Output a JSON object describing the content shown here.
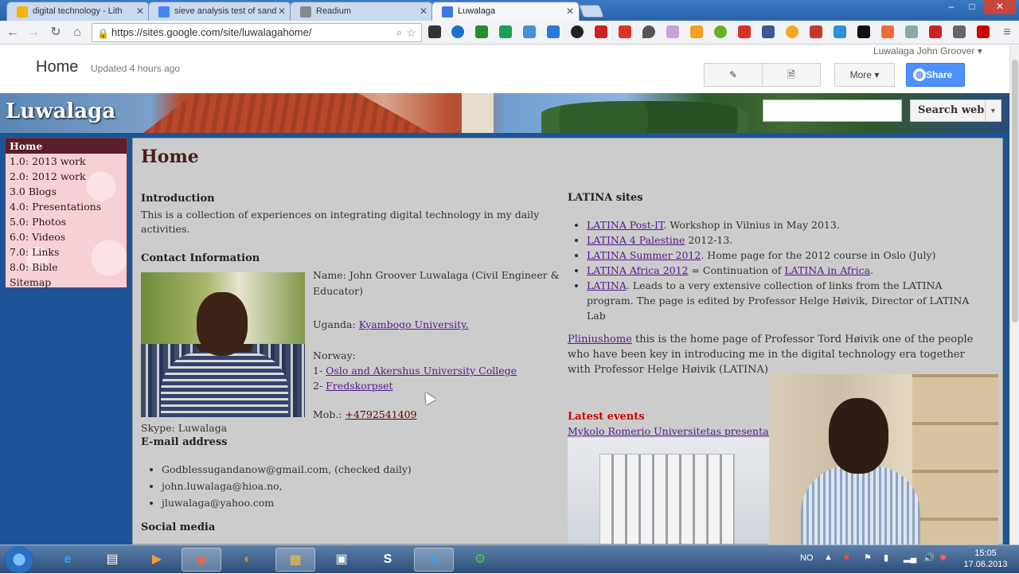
{
  "browser": {
    "tabs": [
      {
        "label": "digital technology - Lith",
        "fav_color": "#f4b400",
        "active": false
      },
      {
        "label": "sieve analysis test of sand",
        "fav_color": "#4285f4",
        "active": false
      },
      {
        "label": "Readium",
        "fav_color": "#888888",
        "active": false
      },
      {
        "label": "Luwalaga",
        "fav_color": "#3b78e7",
        "active": true
      }
    ],
    "url": "https://sites.google.com/site/luwalagahome/",
    "window_controls": [
      "–",
      "□",
      "✕"
    ]
  },
  "sites_header": {
    "page_heading": "Home",
    "updated": "Updated 4 hours ago",
    "user": "Luwalaga John Groover",
    "more_label": "More",
    "share_label": "Share"
  },
  "banner": {
    "site_title": "Luwalaga",
    "search_button": "Search web"
  },
  "sidebar": {
    "items": [
      {
        "label": "Home",
        "active": true
      },
      {
        "label": "1.0: 2013 work"
      },
      {
        "label": "2.0: 2012 work"
      },
      {
        "label": "3.0 Blogs"
      },
      {
        "label": "4.0: Presentations"
      },
      {
        "label": "5.0: Photos"
      },
      {
        "label": "6.0: Videos"
      },
      {
        "label": "7.0: Links"
      },
      {
        "label": "8.0: Bible"
      },
      {
        "label": "Sitemap"
      }
    ]
  },
  "content": {
    "title": "Home",
    "intro_heading": "Introduction",
    "intro_text": "This is a collection of experiences on integrating digital technology in my daily activities.",
    "contact_heading": "Contact Information",
    "name_line": "Name: John Groover Luwalaga (Civil Engineer & Educator)",
    "uganda_prefix": "Uganda:",
    "uganda_link": "Kyambogo University.",
    "norway_label": "Norway:",
    "norway_1_prefix": "1-",
    "norway_1_link": "Oslo and Akershus University College",
    "norway_2_prefix": "2-",
    "norway_2_link": "Fredskorpset",
    "mob_prefix": "Mob.:",
    "mob_link": "+4792541409",
    "skype": "Skype: Luwalaga",
    "email_heading": "E-mail address",
    "emails": [
      "Godblessugandanow@gmail.com, (checked daily)",
      "john.luwalaga@hioa.no,",
      "jluwalaga@yahoo.com"
    ],
    "social_heading": "Social media",
    "latina_heading": "LATINA sites",
    "latina_items": [
      {
        "link": "LATINA Post-IT",
        "text": ". Workshop in Vilnius in May 2013."
      },
      {
        "link": "LATINA 4 Palestine",
        "text": " 2012-13."
      },
      {
        "link": "LATINA Summer 2012",
        "text": ". Home page for the 2012 course in Oslo (July)"
      },
      {
        "link": "LATINA Africa 2012",
        "text": " = Continuation of ",
        "link2": "LATINA in Africa",
        "text2": "."
      },
      {
        "link": "LATINA",
        "text": ". Leads to a very extensive collection of links from the LATINA program. The page is edited by Professor Helge Høivik, Director of LATINA Lab"
      }
    ],
    "plinius_link": "Pliniushome",
    "plinius_text": " this is the home page of Professor Tord Høivik one of the people who have been key in introducing me in the digital technology era together with Professor Helge Høivik (LATINA)",
    "latest_heading": "Latest events",
    "latest_link": "Mykolo Romerio Universitetas presentations (May 23 2013)"
  },
  "taskbar": {
    "language": "NO",
    "time": "15:05",
    "date": "17.06.2013"
  },
  "colors": {
    "page_bg": "#1d5499",
    "nav_active": "#5a1f2a",
    "share_blue": "#4d90fe",
    "latest_red": "#cc0000"
  }
}
